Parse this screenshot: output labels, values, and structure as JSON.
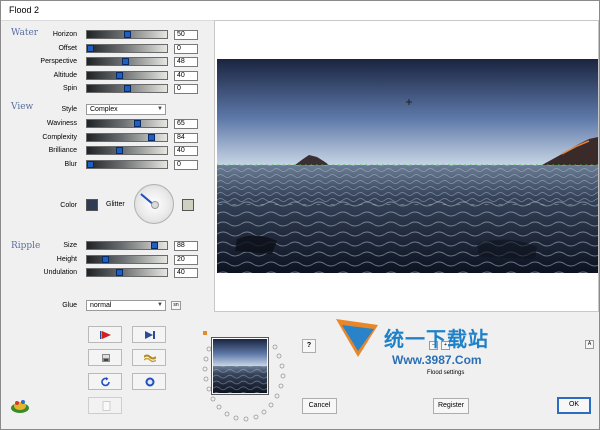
{
  "window": {
    "title": "Flood 2"
  },
  "sections": {
    "water": "Water",
    "view": "View",
    "ripple": "Ripple"
  },
  "water": [
    {
      "label": "Horizon",
      "value": "50",
      "fraction": 0.5
    },
    {
      "label": "Offset",
      "value": "0",
      "fraction": 0.0
    },
    {
      "label": "Perspective",
      "value": "48",
      "fraction": 0.48
    },
    {
      "label": "Altitude",
      "value": "40",
      "fraction": 0.4
    },
    {
      "label": "Spin",
      "value": "0",
      "fraction": 0.5
    }
  ],
  "view": {
    "style_label": "Style",
    "style_value": "Complex",
    "sliders": [
      {
        "label": "Waviness",
        "value": "65",
        "fraction": 0.65
      },
      {
        "label": "Complexity",
        "value": "84",
        "fraction": 0.84
      },
      {
        "label": "Brilliance",
        "value": "40",
        "fraction": 0.4
      },
      {
        "label": "Blur",
        "value": "0",
        "fraction": 0.0
      }
    ],
    "color_label": "Color",
    "glitter_label": "Glitter",
    "color_swatch": "#2f3a55",
    "glitter_swatch": "#cfcfc2"
  },
  "ripple": [
    {
      "label": "Size",
      "value": "88",
      "fraction": 0.88
    },
    {
      "label": "Height",
      "value": "20",
      "fraction": 0.2
    },
    {
      "label": "Undulation",
      "value": "40",
      "fraction": 0.4
    }
  ],
  "glue": {
    "label": "Glue",
    "value": "normal"
  },
  "tools": [
    {
      "name": "play-icon"
    },
    {
      "name": "step-icon"
    },
    {
      "name": "stamp-icon"
    },
    {
      "name": "wave-icon"
    },
    {
      "name": "rotate-icon"
    },
    {
      "name": "ring-icon"
    },
    {
      "name": "page-icon"
    }
  ],
  "buttons": {
    "help": "?",
    "cancel": "Cancel",
    "register": "Register",
    "ok": "OK",
    "minus": "–",
    "plus": "+",
    "up": "A",
    "sn": "sn"
  },
  "watermark": {
    "cn": "统一下载站",
    "url": "Www.3987.Com",
    "settings": "Flood settings"
  },
  "colors": {
    "accent": "#5a6fa0",
    "thumb": "#1f5fbf",
    "ok_border": "#2b6cc4"
  }
}
